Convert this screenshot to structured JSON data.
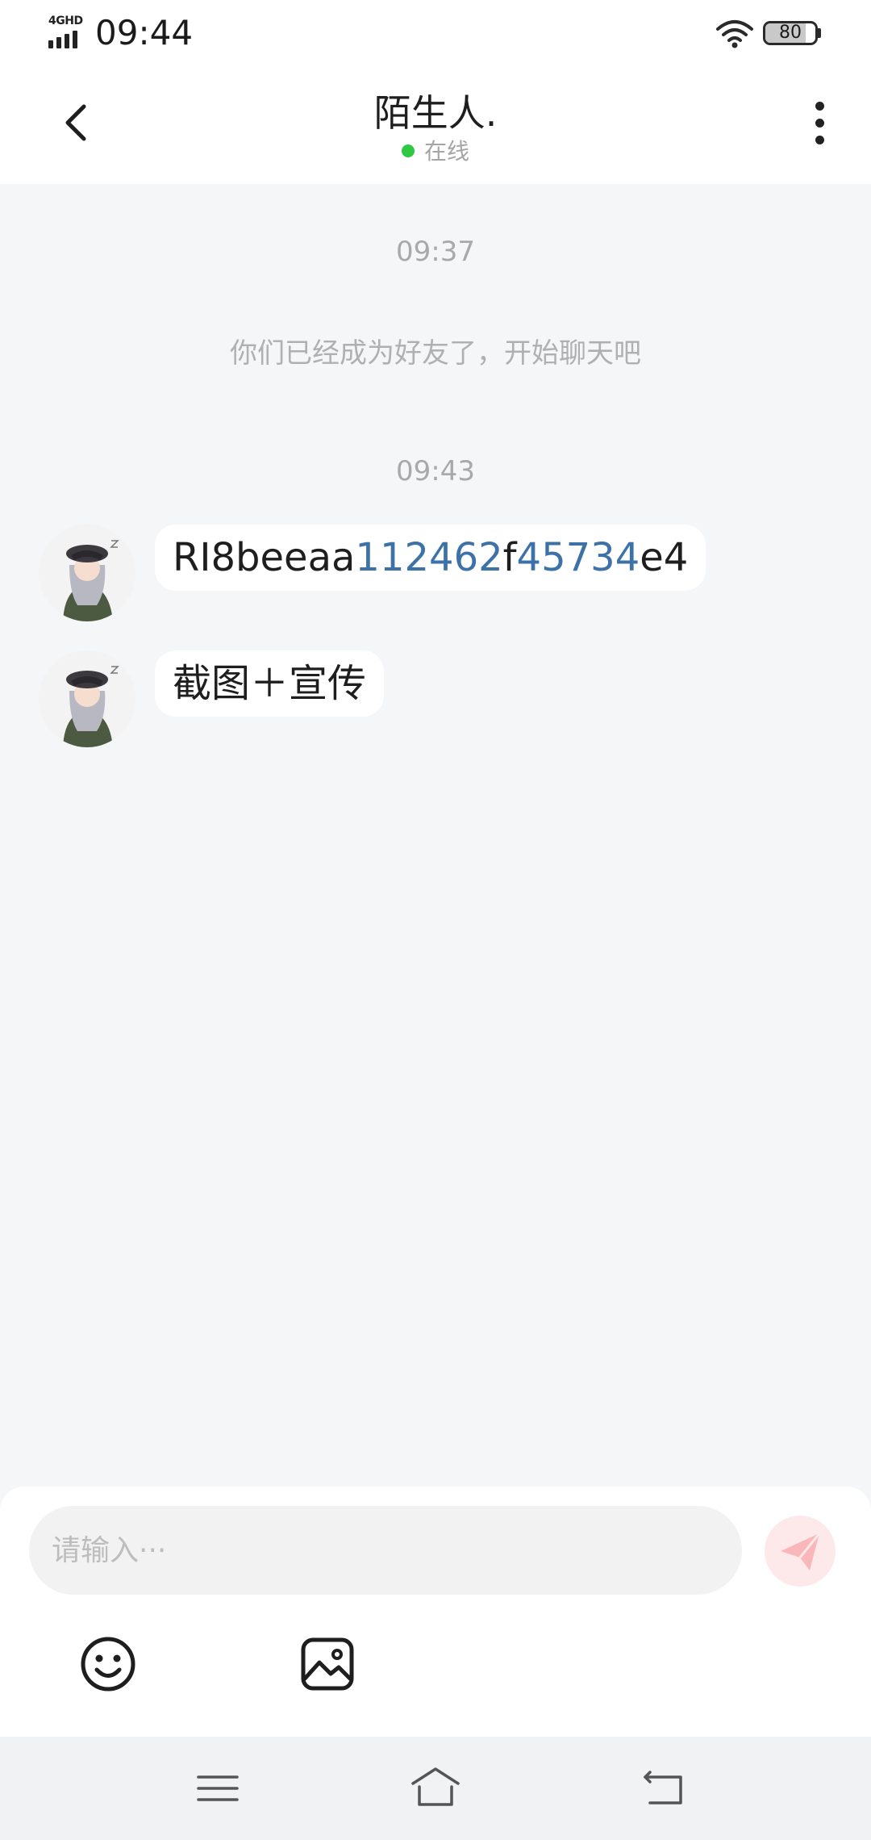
{
  "status_bar": {
    "network": "4GHD",
    "time": "09:44",
    "battery": "80",
    "battery_level": 0.8,
    "icons": [
      "signal-icon",
      "wifi-icon",
      "battery-icon"
    ]
  },
  "header": {
    "title": "陌生人.",
    "status": "在线",
    "status_color": "#2ec843",
    "back_icon": "chevron-left-icon",
    "more_icon": "more-vertical-icon"
  },
  "chat": {
    "separators": [
      {
        "time": "09:37"
      },
      {
        "time": "09:43"
      }
    ],
    "system_message": "你们已经成为好友了，开始聊天吧",
    "messages": [
      {
        "parts": [
          {
            "text": "RI8beeaa",
            "link": false
          },
          {
            "text": "112462",
            "link": true
          },
          {
            "text": "f",
            "link": false
          },
          {
            "text": "45734",
            "link": true
          },
          {
            "text": "e4",
            "link": false
          }
        ]
      },
      {
        "parts": [
          {
            "text": "截图＋宣传",
            "link": false
          }
        ]
      }
    ],
    "link_color": "#3d72a8"
  },
  "input": {
    "placeholder": "请输入···",
    "value": "",
    "send_icon": "send-icon",
    "emoji_icon": "emoji-icon",
    "image_icon": "image-icon"
  },
  "nav_bar": {
    "icons": [
      "menu-icon",
      "home-icon",
      "back-icon"
    ]
  },
  "colors": {
    "background": "#f5f6f8",
    "bubble": "#ffffff",
    "send_button": "#fde9ea",
    "send_icon": "#f9b7ba"
  }
}
